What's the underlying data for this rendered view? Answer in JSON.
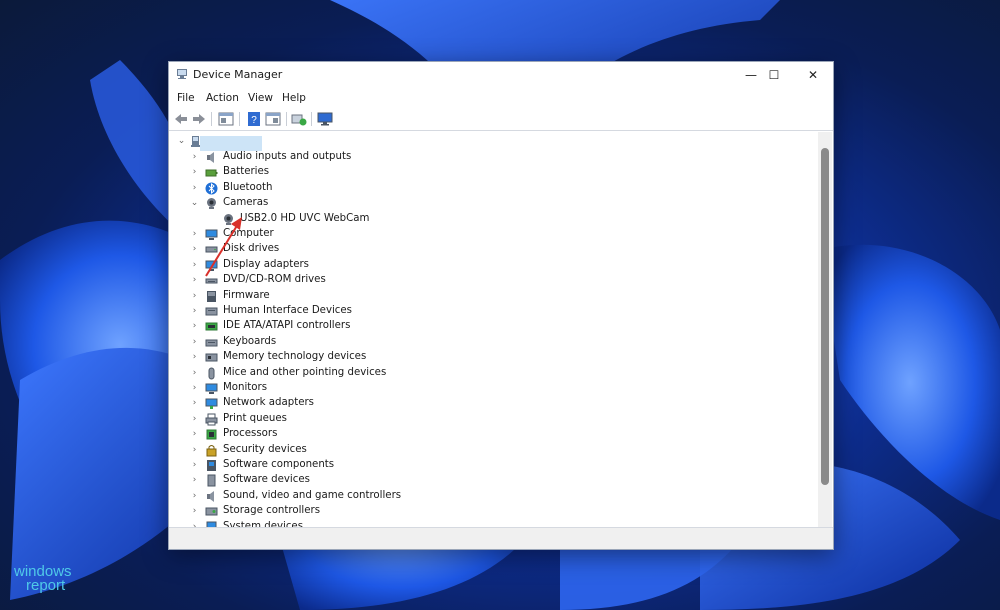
{
  "window": {
    "title": "Device Manager",
    "minimize_glyph": "—",
    "maximize_glyph": "☐",
    "close_glyph": "✕"
  },
  "menu": [
    "File",
    "Action",
    "View",
    "Help"
  ],
  "toolbar": [
    "back-icon",
    "forward-icon",
    "properties-icon",
    "help-icon",
    "view-icon",
    "scan-icon",
    "monitor-icon"
  ],
  "tree": {
    "root_label": "",
    "items": [
      {
        "label": "Audio inputs and outputs",
        "icon": "speaker-icon",
        "expanded": false
      },
      {
        "label": "Batteries",
        "icon": "battery-icon",
        "expanded": false
      },
      {
        "label": "Bluetooth",
        "icon": "bluetooth-icon",
        "expanded": false
      },
      {
        "label": "Cameras",
        "icon": "camera-icon",
        "expanded": true
      },
      {
        "label": "USB2.0 HD UVC WebCam",
        "icon": "webcam-icon",
        "child": true
      },
      {
        "label": "Computer",
        "icon": "computer-icon",
        "expanded": false
      },
      {
        "label": "Disk drives",
        "icon": "disk-icon",
        "expanded": false
      },
      {
        "label": "Display adapters",
        "icon": "display-icon",
        "expanded": false
      },
      {
        "label": "DVD/CD-ROM drives",
        "icon": "dvd-icon",
        "expanded": false
      },
      {
        "label": "Firmware",
        "icon": "firmware-icon",
        "expanded": false
      },
      {
        "label": "Human Interface Devices",
        "icon": "hid-icon",
        "expanded": false
      },
      {
        "label": "IDE ATA/ATAPI controllers",
        "icon": "ide-icon",
        "expanded": false
      },
      {
        "label": "Keyboards",
        "icon": "keyboard-icon",
        "expanded": false
      },
      {
        "label": "Memory technology devices",
        "icon": "memory-icon",
        "expanded": false
      },
      {
        "label": "Mice and other pointing devices",
        "icon": "mouse-icon",
        "expanded": false
      },
      {
        "label": "Monitors",
        "icon": "monitor-icon",
        "expanded": false
      },
      {
        "label": "Network adapters",
        "icon": "network-icon",
        "expanded": false
      },
      {
        "label": "Print queues",
        "icon": "printer-icon",
        "expanded": false
      },
      {
        "label": "Processors",
        "icon": "processor-icon",
        "expanded": false
      },
      {
        "label": "Security devices",
        "icon": "security-icon",
        "expanded": false
      },
      {
        "label": "Software components",
        "icon": "software-component-icon",
        "expanded": false
      },
      {
        "label": "Software devices",
        "icon": "software-device-icon",
        "expanded": false
      },
      {
        "label": "Sound, video and game controllers",
        "icon": "sound-icon",
        "expanded": false
      },
      {
        "label": "Storage controllers",
        "icon": "storage-icon",
        "expanded": false
      },
      {
        "label": "System devices",
        "icon": "system-icon",
        "expanded": false
      }
    ]
  },
  "watermark": {
    "line1": "windows",
    "line2": "report"
  },
  "colors": {
    "accent": "#1a5fd1",
    "selection": "#cde4f7",
    "arrow": "#d9302a"
  }
}
